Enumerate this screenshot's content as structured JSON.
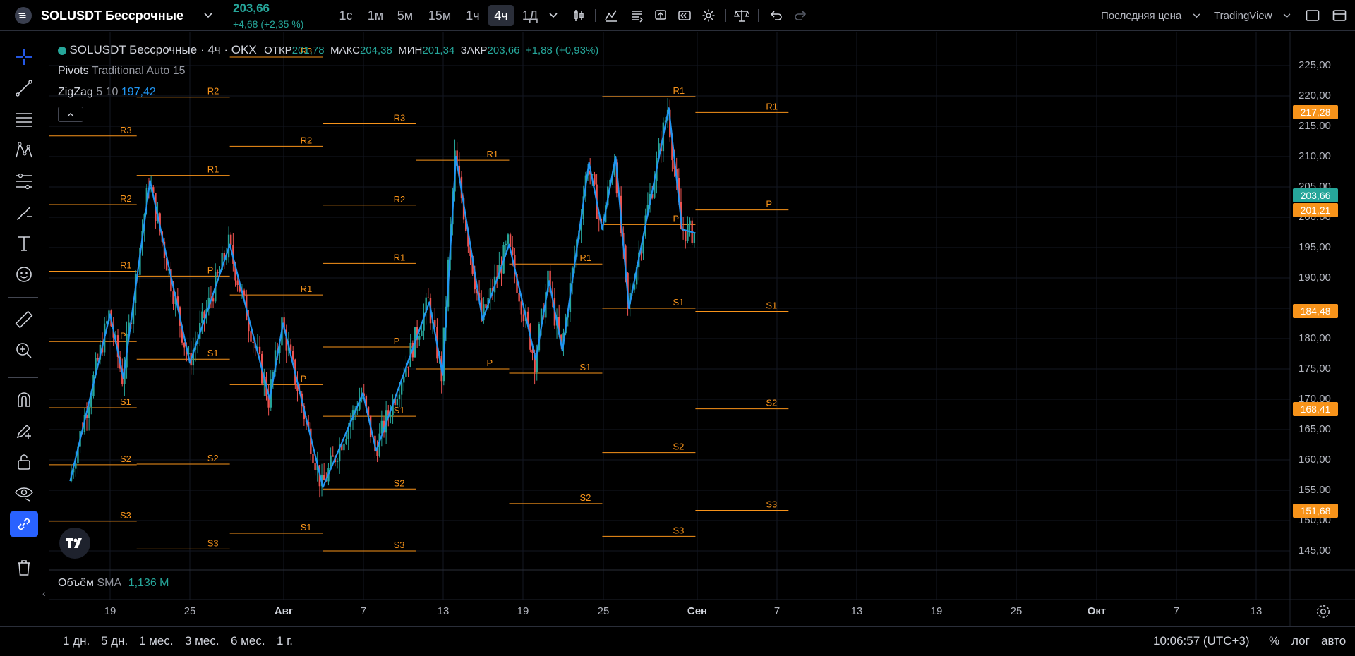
{
  "header": {
    "symbol": "SOLUSDT Бессрочные",
    "price": "203,66",
    "change": "+4,68 (+2,35 %)",
    "timeframes": [
      "1с",
      "1м",
      "5м",
      "15м",
      "1ч",
      "4ч",
      "1Д"
    ],
    "active_timeframe": "4ч",
    "price_type": "Последняя цена",
    "broker": "TradingView"
  },
  "legend": {
    "symbol_line": "SOLUSDT Бессрочные · 4ч · OKX",
    "open_label": "ОТКР",
    "open": "201,78",
    "high_label": "МАКС",
    "high": "204,38",
    "low_label": "МИН",
    "low": "201,34",
    "close_label": "ЗАКР",
    "close": "203,66",
    "change": "+1,88 (+0,93%)",
    "pivots_name": "Pivots",
    "pivots_params": "Traditional Auto 15",
    "zigzag_name": "ZigZag",
    "zigzag_params": "5 10",
    "zigzag_value": "197,42",
    "volume_name": "Объём",
    "volume_params": "SMA",
    "volume_value": "1,136 M"
  },
  "price_axis": {
    "ticks": [
      "225,00",
      "220,00",
      "215,00",
      "210,00",
      "205,00",
      "200,00",
      "195,00",
      "190,00",
      "185,00",
      "180,00",
      "175,00",
      "170,00",
      "165,00",
      "160,00",
      "155,00",
      "150,00",
      "145,00"
    ],
    "tags": [
      {
        "value": "217,28",
        "color": "#f7931a"
      },
      {
        "value": "203,66",
        "color": "#26a69a"
      },
      {
        "value": "201,21",
        "color": "#f7931a"
      },
      {
        "value": "184,48",
        "color": "#f7931a"
      },
      {
        "value": "168,41",
        "color": "#f7931a"
      },
      {
        "value": "151,68",
        "color": "#f7931a"
      }
    ]
  },
  "time_axis": {
    "ticks": [
      "19",
      "25",
      "Авг",
      "7",
      "13",
      "19",
      "25",
      "Сен",
      "7",
      "13",
      "19",
      "25",
      "Окт",
      "7",
      "13"
    ]
  },
  "bottom": {
    "ranges": [
      "1 дн.",
      "5 дн.",
      "1 мес.",
      "3 мес.",
      "6 мес.",
      "1 г."
    ],
    "clock": "10:06:57 (UTC+3)",
    "percent": "%",
    "log": "лог",
    "auto": "авто"
  },
  "colors": {
    "up": "#26a69a",
    "down": "#ef5350",
    "pivot": "#f7931a",
    "zigzag": "#2196f3",
    "accent": "#2962ff"
  },
  "chart_data": {
    "type": "candlestick",
    "title": "SOLUSDT Бессрочные · 4ч · OKX",
    "ylim": [
      140,
      227
    ],
    "zigzag": [
      {
        "x": "2024-07-16",
        "y": 156.5
      },
      {
        "x": "2024-07-19",
        "y": 184
      },
      {
        "x": "2024-07-20",
        "y": 173.5
      },
      {
        "x": "2024-07-22",
        "y": 206
      },
      {
        "x": "2024-07-25",
        "y": 176
      },
      {
        "x": "2024-07-28",
        "y": 195.5
      },
      {
        "x": "2024-07-31",
        "y": 170
      },
      {
        "x": "2024-08-01",
        "y": 182.5
      },
      {
        "x": "2024-08-04",
        "y": 155.5
      },
      {
        "x": "2024-08-07",
        "y": 171
      },
      {
        "x": "2024-08-08",
        "y": 161.5
      },
      {
        "x": "2024-08-12",
        "y": 186
      },
      {
        "x": "2024-08-13",
        "y": 174
      },
      {
        "x": "2024-08-14",
        "y": 210
      },
      {
        "x": "2024-08-16",
        "y": 183
      },
      {
        "x": "2024-08-18",
        "y": 195.5
      },
      {
        "x": "2024-08-20",
        "y": 176.5
      },
      {
        "x": "2024-08-21",
        "y": 189.5
      },
      {
        "x": "2024-08-22",
        "y": 178
      },
      {
        "x": "2024-08-24",
        "y": 209
      },
      {
        "x": "2024-08-25",
        "y": 198
      },
      {
        "x": "2024-08-26",
        "y": 210
      },
      {
        "x": "2024-08-27",
        "y": 185
      },
      {
        "x": "2024-08-30",
        "y": 218
      },
      {
        "x": "2024-08-31",
        "y": 198
      },
      {
        "x": "2024-09-01",
        "y": 197.4
      }
    ],
    "pivot_periods": [
      {
        "from": "2024-07-14",
        "to": "2024-07-21",
        "levels": {
          "R3": 213.4,
          "R2": 202.1,
          "R1": 191.1,
          "P": 179.5,
          "S1": 168.6,
          "S2": 159.2,
          "S3": 149.9
        }
      },
      {
        "from": "2024-07-21",
        "to": "2024-07-28",
        "levels": {
          "R2": 219.8,
          "R1": 206.9,
          "P": 190.3,
          "S1": 176.6,
          "S2": 159.3,
          "S3": 145.3
        }
      },
      {
        "from": "2024-07-28",
        "to": "2024-08-04",
        "levels": {
          "R3": 226.4,
          "R2": 211.7,
          "R1": 187.2,
          "P": 172.4,
          "S1": 147.9
        }
      },
      {
        "from": "2024-08-04",
        "to": "2024-08-11",
        "levels": {
          "R3": 215.4,
          "R2": 202.0,
          "R1": 192.4,
          "P": 178.6,
          "S1": 167.2,
          "S2": 155.2,
          "S3": 145.0
        }
      },
      {
        "from": "2024-08-11",
        "to": "2024-08-18",
        "levels": {
          "R1": 209.4,
          "P": 175.0
        }
      },
      {
        "from": "2024-08-18",
        "to": "2024-08-25",
        "levels": {
          "R1": 192.3,
          "S1": 174.3,
          "S2": 152.8
        }
      },
      {
        "from": "2024-08-25",
        "to": "2024-09-01",
        "levels": {
          "R1": 219.9,
          "P": 198.8,
          "S1": 185.0,
          "S2": 161.2,
          "S3": 147.4
        }
      },
      {
        "from": "2024-09-01",
        "to": "2024-09-08",
        "levels": {
          "R1": 217.28,
          "P": 201.21,
          "S1": 184.48,
          "S2": 168.41,
          "S3": 151.68
        }
      }
    ]
  }
}
